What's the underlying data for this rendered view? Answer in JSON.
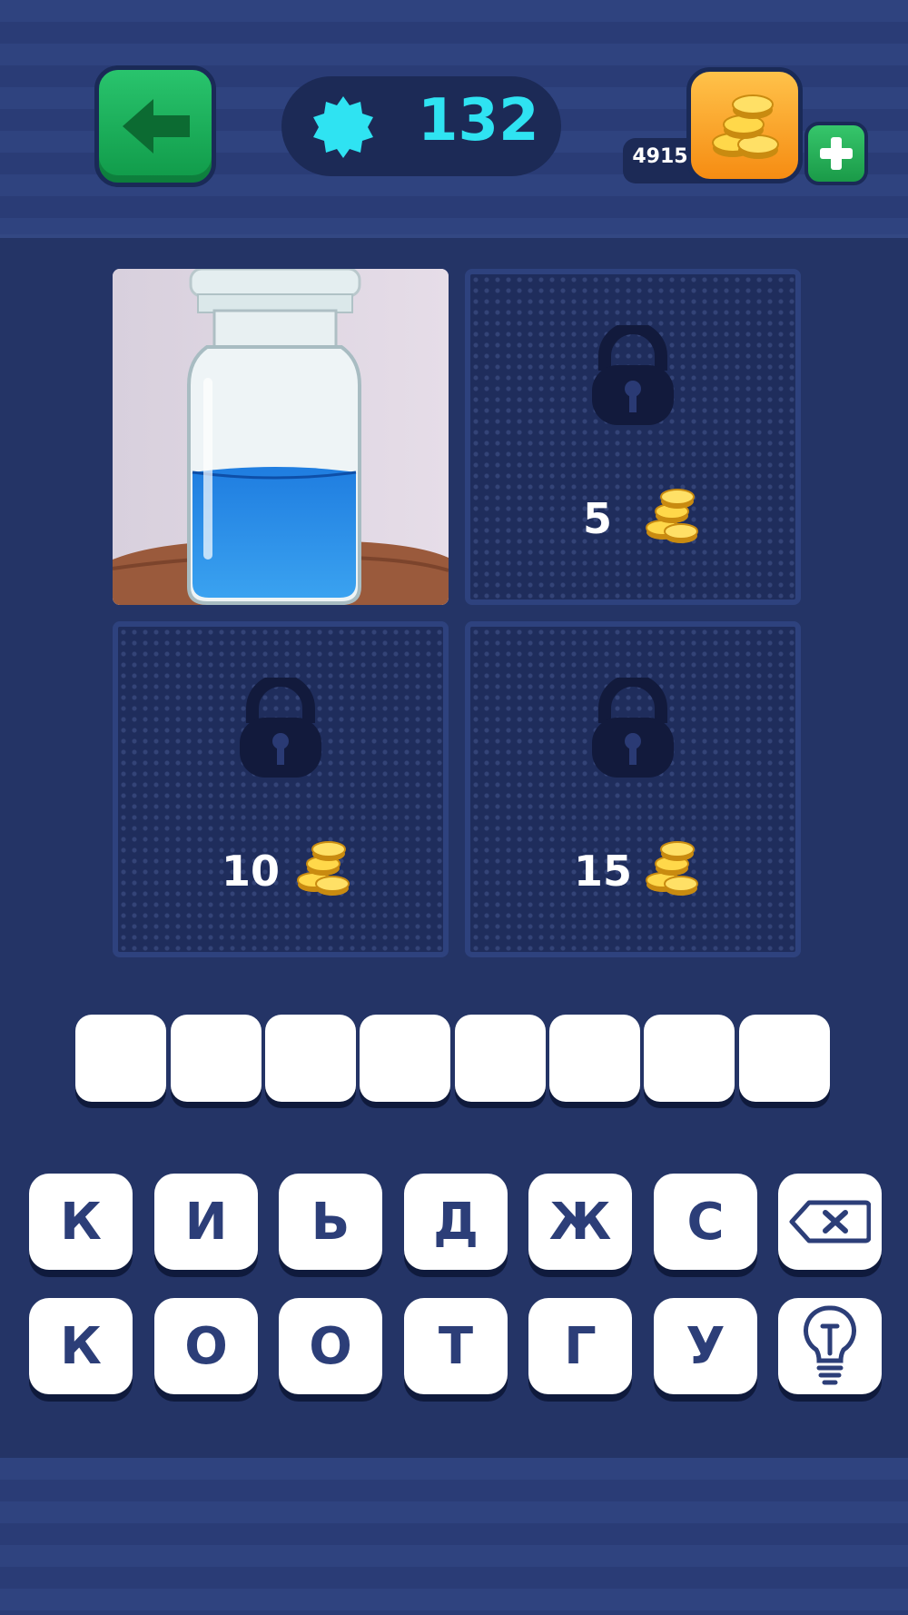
{
  "header": {
    "level": "132",
    "coins": "4915"
  },
  "tiles": [
    {
      "state": "revealed",
      "description": "glass jar with blue liquid"
    },
    {
      "state": "locked",
      "cost": "5"
    },
    {
      "state": "locked",
      "cost": "10"
    },
    {
      "state": "locked",
      "cost": "15"
    }
  ],
  "answer": {
    "slots": [
      "",
      "",
      "",
      "",
      "",
      "",
      "",
      ""
    ]
  },
  "keyboard": {
    "row1": [
      "К",
      "И",
      "Ь",
      "Д",
      "Ж",
      "С"
    ],
    "row2": [
      "К",
      "О",
      "О",
      "Т",
      "Г",
      "У"
    ],
    "backspace_icon": "backspace-icon",
    "hint_icon": "lightbulb-icon"
  },
  "colors": {
    "background": "#243466",
    "level_text": "#2fe3f2",
    "key_text": "#2c3e78",
    "back_button": "#1bab55",
    "coin_button": "#f9a425"
  }
}
